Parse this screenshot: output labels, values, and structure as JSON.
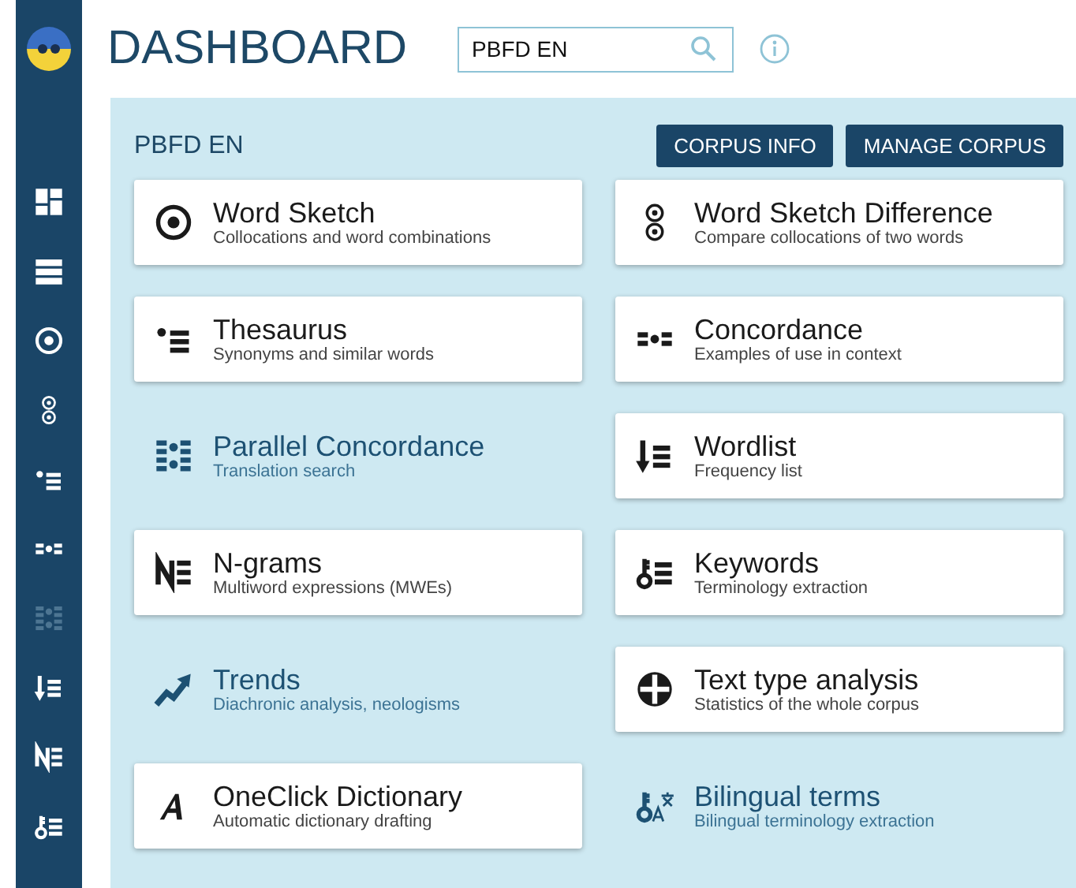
{
  "page": {
    "title": "DASHBOARD"
  },
  "search": {
    "value": "PBFD EN"
  },
  "sidebar": {
    "items": [
      {
        "disabled": false
      },
      {
        "disabled": false
      },
      {
        "disabled": false
      },
      {
        "disabled": false
      },
      {
        "disabled": false
      },
      {
        "disabled": false
      },
      {
        "disabled": true
      },
      {
        "disabled": false
      },
      {
        "disabled": false
      },
      {
        "disabled": false
      }
    ]
  },
  "corpus": {
    "name": "PBFD EN",
    "buttons": [
      "CORPUS INFO",
      "MANAGE CORPUS"
    ]
  },
  "tools": [
    {
      "title": "Word Sketch",
      "subtitle": "Collocations and word combinations",
      "disabled": false
    },
    {
      "title": "Word Sketch Difference",
      "subtitle": "Compare collocations of two words",
      "disabled": false
    },
    {
      "title": "Thesaurus",
      "subtitle": "Synonyms and similar words",
      "disabled": false
    },
    {
      "title": "Concordance",
      "subtitle": "Examples of use in context",
      "disabled": false
    },
    {
      "title": "Parallel Concordance",
      "subtitle": "Translation search",
      "disabled": true
    },
    {
      "title": "Wordlist",
      "subtitle": "Frequency list",
      "disabled": false
    },
    {
      "title": "N-grams",
      "subtitle": "Multiword expressions (MWEs)",
      "disabled": false
    },
    {
      "title": "Keywords",
      "subtitle": "Terminology extraction",
      "disabled": false
    },
    {
      "title": "Trends",
      "subtitle": "Diachronic analysis, neologisms",
      "disabled": true
    },
    {
      "title": "Text type analysis",
      "subtitle": "Statistics of the whole corpus",
      "disabled": false
    },
    {
      "title": "OneClick Dictionary",
      "subtitle": "Automatic dictionary drafting",
      "disabled": false
    },
    {
      "title": "Bilingual terms",
      "subtitle": "Bilingual terminology extraction",
      "disabled": true
    }
  ]
}
